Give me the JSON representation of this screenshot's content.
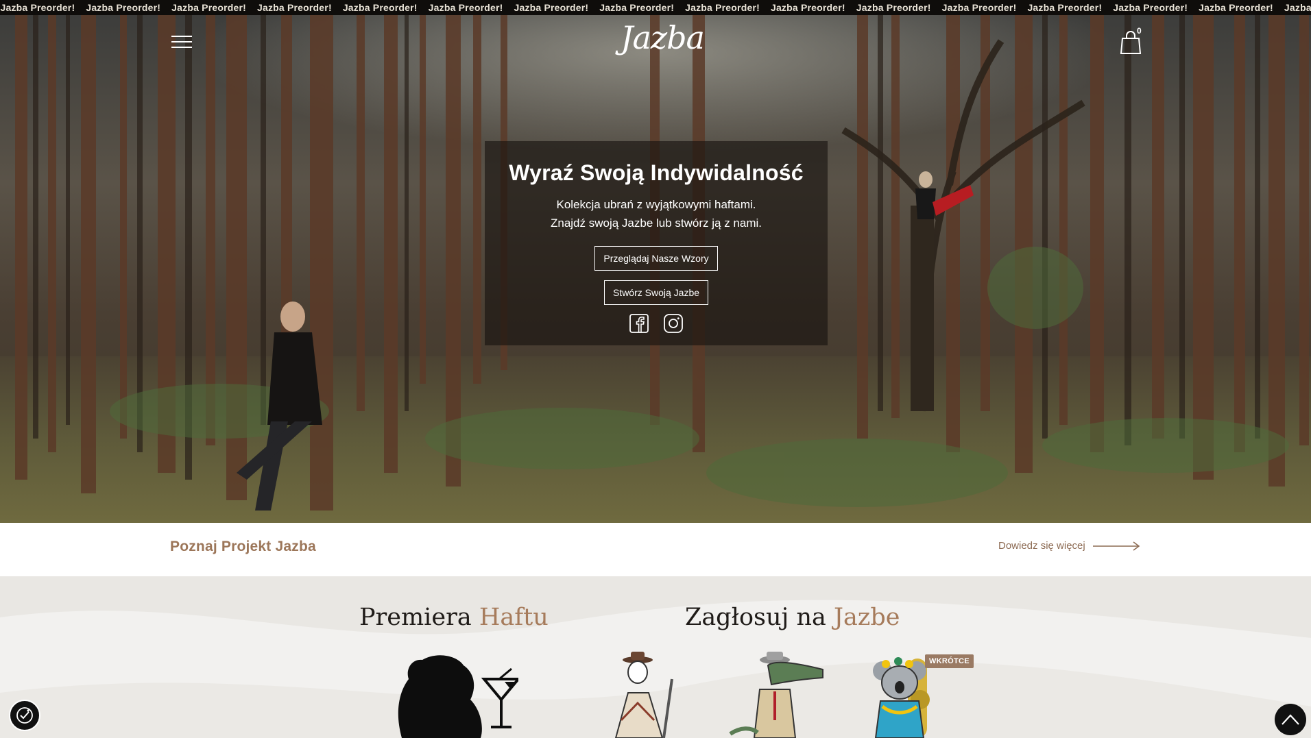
{
  "marquee": {
    "items": [
      "er!",
      "Jazba Preorder!",
      "Jazba Preorder!",
      "Jazba Preorder!",
      "Jazba Preorder!",
      "Jazba Preorder!",
      "Jazba Preorder!",
      "Jazba Preorder!",
      "Jazba Preorder!",
      "Jazba Preorder!",
      "Jazba Preorder!",
      "Jazba Preorder!",
      "Jazba Preorder!",
      "Jazba Preorder!",
      "Jazba Preorder!",
      "Jazba Preorder!",
      "Jazba Preorder!",
      "Jazba Pre"
    ]
  },
  "header": {
    "menu_icon": "hamburger-menu-icon",
    "logo_text": "Jazba",
    "cart_icon": "shopping-bag-icon",
    "cart_count": "0"
  },
  "hero": {
    "title": "Wyraź Swoją Indywidalność",
    "subtitle_line1": "Kolekcja ubrań z wyjątkowymi haftami.",
    "subtitle_line2": "Znajdź swoją Jazbe lub stwórz ją z nami.",
    "button_browse": "Przeglądaj Nasze Wzory",
    "button_create": "Stwórz Swoją Jazbe",
    "social_icons": [
      "facebook-icon",
      "instagram-icon"
    ]
  },
  "strip": {
    "title": "Poznaj Projekt Jazba",
    "link": "Dowiedz się więcej",
    "link_icon": "long-arrow-right-icon"
  },
  "sections": {
    "premiere_title": "Premiera ",
    "premiere_accent": "Haftu",
    "vote_title": "Zagłosuj na ",
    "vote_accent": "Jazbe",
    "badge": "WKRÓTCE"
  },
  "floating": {
    "accessibility_icon": "accessibility-icon",
    "scroll_top_icon": "chevron-up-icon"
  },
  "colors": {
    "accent": "#a67b5b",
    "marquee_bg": "#0f0d0b",
    "hero_overlay": "#16120e"
  }
}
